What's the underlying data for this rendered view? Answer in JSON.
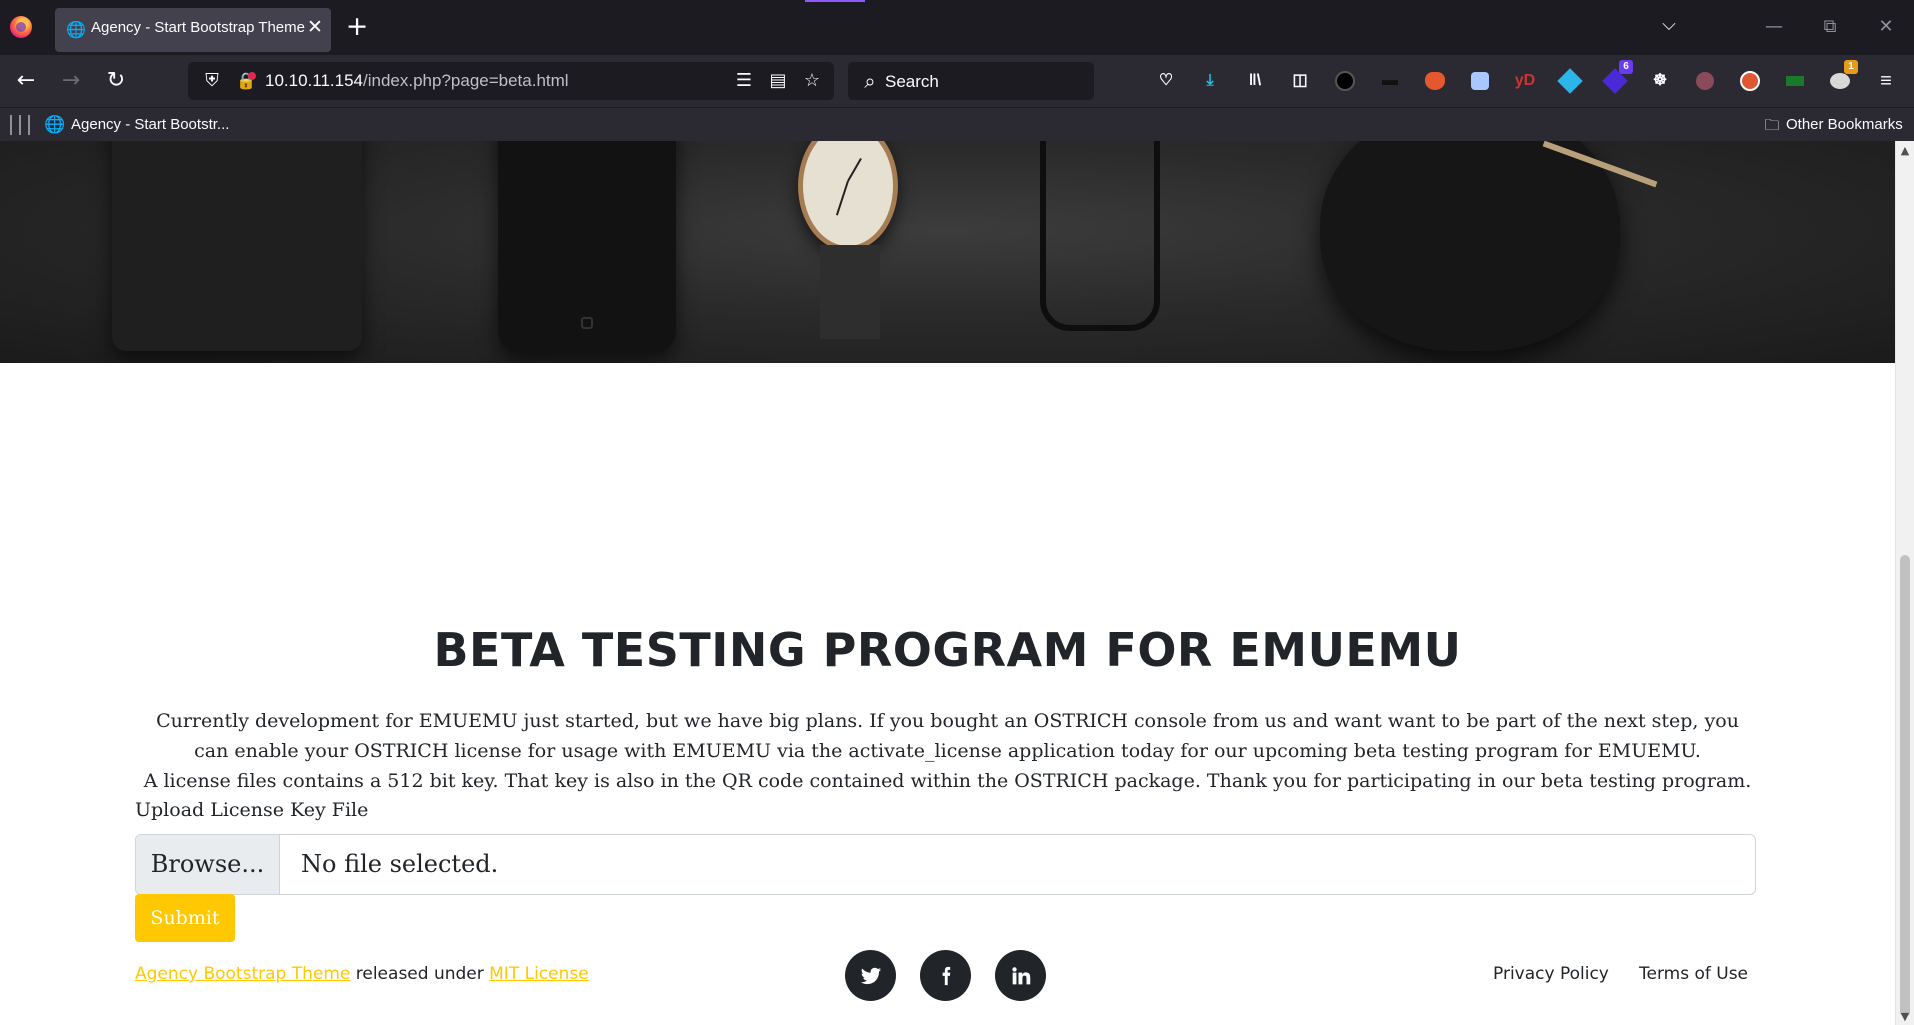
{
  "browser": {
    "tab_title": "Agency - Start Bootstrap Theme",
    "url_host": "10.10.11.154",
    "url_path": "/index.php?page=beta.html",
    "search_placeholder": "Search",
    "bookmark_label": "Agency - Start Bootstr...",
    "other_bookmarks": "Other Bookmarks",
    "toolbar_icons": [
      "pocket-icon",
      "downloads-icon",
      "library-icon",
      "sidebar-icon",
      "extension-black-icon",
      "extension-hat-icon",
      "extension-fox-icon",
      "extension-cube-icon",
      "extension-yd-icon",
      "extension-wappalyzer-icon",
      "extension-badge-6-icon",
      "cookie-icon",
      "extension-dots-icon",
      "duckduckgo-icon",
      "extension-green-icon",
      "extension-badge-1-icon",
      "menu-icon"
    ],
    "extension_yd_label": "yD",
    "badge_6": "6",
    "badge_1": "1",
    "accent_color": "#9059ff"
  },
  "page": {
    "heading": "BETA TESTING PROGRAM FOR EMUEMU",
    "intro_line1": "Currently development for EMUEMU just started, but we have big plans. If you bought an OSTRICH console from us and want want to be part of the next step, you can enable your OSTRICH license for usage with EMUEMU via the activate_license application today for our upcoming beta testing program for EMUEMU.",
    "intro_line2": "A license files contains a 512 bit key. That key is also in the QR code contained within the OSTRICH package. Thank you for participating in our beta testing program.",
    "upload_label": "Upload License Key File",
    "browse_label": "Browse...",
    "file_status": "No file selected.",
    "submit_label": "Submit",
    "brand_color": "#ffc800"
  },
  "footer": {
    "theme_link": "Agency Bootstrap Theme",
    "released_text": " released under ",
    "license_link": "MIT License",
    "privacy": "Privacy Policy",
    "terms": "Terms of Use",
    "social_icons": [
      "twitter-icon",
      "facebook-icon",
      "linkedin-icon"
    ]
  }
}
